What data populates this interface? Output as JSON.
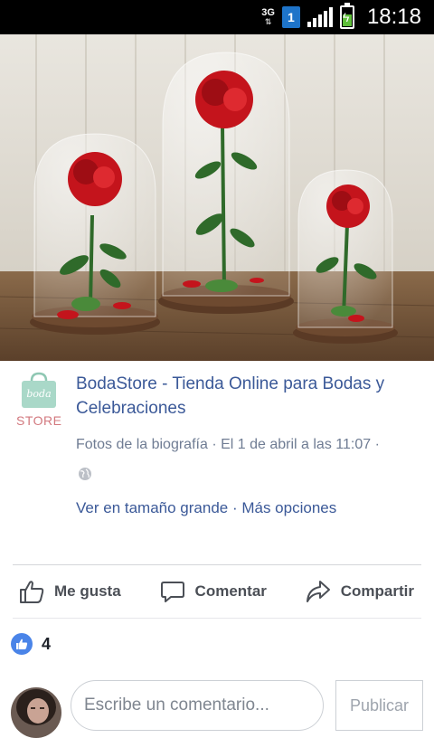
{
  "status_bar": {
    "network_type": "3G",
    "sim_slot": "1",
    "time": "18:18"
  },
  "post": {
    "page_name": "BodaStore - Tienda Online para Bodas y Celebraciones",
    "logo_text_top": "boda",
    "logo_text_bottom": "STORE",
    "meta_text": "Fotos de la biografía · El 1 de abril a las 11:07 ·",
    "options_text": "Ver en tamaño grande · Más opciones",
    "photo_description_icon": "rose-in-glass-dome-image"
  },
  "actions": {
    "like_label": "Me gusta",
    "comment_label": "Comentar",
    "share_label": "Compartir"
  },
  "reactions": {
    "like_count": "4"
  },
  "composer": {
    "placeholder": "Escribe un comentario...",
    "publish_label": "Publicar"
  },
  "colors": {
    "brand_link": "#3b5998",
    "meta_gray": "#6f7c93",
    "like_blue": "#4a84e8"
  }
}
